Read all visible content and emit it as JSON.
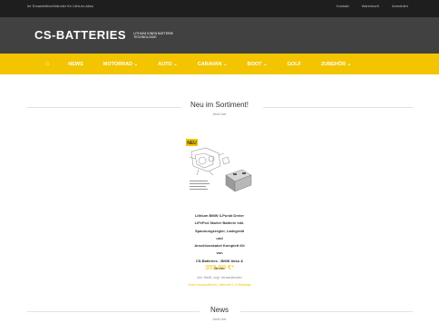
{
  "topbar": {
    "notice": "Ihr Ersatzteilfachhändler für Lithium-Akku",
    "links": [
      "Kontakt",
      "Warenkorb",
      "Anmelden"
    ]
  },
  "header": {
    "logo_text": "CS-BATTERIES",
    "logo_tagline": "LITHIUM IONEN BATTERIE TECHNOLOGIE"
  },
  "nav": {
    "items": [
      "NEWS",
      "MOTORRAD ⌄",
      "AUTO ⌄",
      "CARAVAN ⌄",
      "BOOT ⌄",
      "GOLF",
      "ZUBEHÖR ⌄"
    ]
  },
  "sortiment": {
    "title": "Neu im Sortiment!",
    "subtitle": "Jetzt hier",
    "product": {
      "badge": "NEU",
      "title_lines": [
        "Lithium BMW 3-Punkt Dreier",
        "LiFePo4 Starter Batterie inkl.",
        "Spannungsregler, Ladegerät und",
        "Anschlusskabel Komplett Kit von",
        "CS-Batteries - BMW Akku & Dreier"
      ],
      "price": "359,00 €*",
      "tax_note": "inkl. MwSt. zzgl. Versandkosten",
      "shipping": "Sofort versandbereit, Lieferzeit 1-3 Werktage"
    }
  },
  "news": {
    "title": "News",
    "subtitle": "Jetzt hier"
  },
  "colors": {
    "accent": "#f2c500",
    "topbar": "#1e1e1e",
    "header": "#414141"
  }
}
